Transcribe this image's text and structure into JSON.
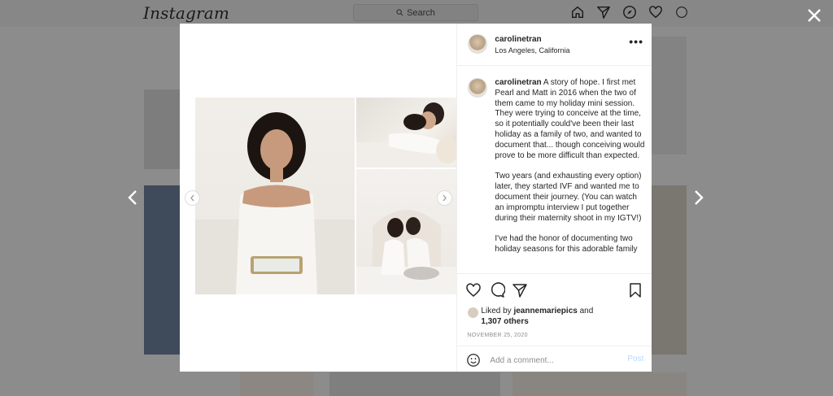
{
  "app": {
    "logo": "Instagram"
  },
  "header": {
    "search_placeholder": "Search"
  },
  "post": {
    "username": "carolinetran",
    "location": "Los Angeles, California",
    "more_label": "•••",
    "caption_paragraphs": [
      "A story of hope. I first met Pearl and Matt in 2016 when the two of them came to my holiday mini session. They were trying to conceive at the time, so it potentially could've been their last holiday as a family of two, and wanted to document that... though conceiving would prove to be more difficult than expected.",
      "Two years (and exhausting every option) later, they started IVF and wanted me to document their journey. (You can watch an impromptu interview I put together during their maternity shoot in my IGTV!)",
      "I've had the honor of documenting two holiday seasons for this adorable family"
    ],
    "liked_prefix": "Liked by",
    "liked_user": "jeannemariepics",
    "liked_and": "and",
    "liked_count": "1,307 others",
    "date": "NOVEMBER 25, 2020",
    "comment_placeholder": "Add a comment...",
    "post_label": "Post"
  },
  "icons": {
    "close": "close-icon",
    "prev": "chevron-left-icon",
    "next": "chevron-right-icon",
    "like": "heart-icon",
    "comment": "comment-icon",
    "share": "send-icon",
    "save": "bookmark-icon",
    "emoji": "emoji-icon"
  },
  "colors": {
    "accent": "#0095f6",
    "post_disabled": "#b3dbff"
  }
}
